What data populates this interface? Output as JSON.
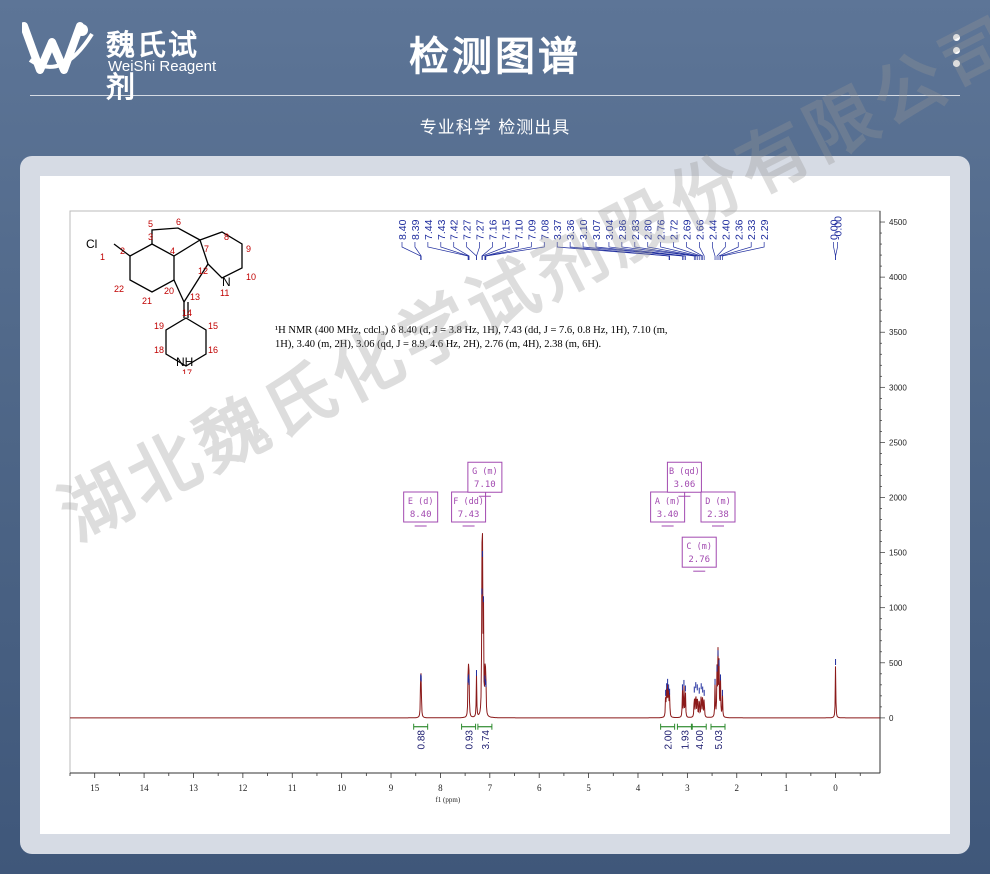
{
  "header": {
    "brand_cn": "魏氏试剂",
    "brand_en": "WeiShi Reagent",
    "title": "检测图谱",
    "subtitle": "专业科学  检测出具"
  },
  "watermark": "湖北魏氏化学试剂股份有限公司",
  "nmr_description": "¹H NMR (400 MHz, cdcl₃) δ 8.40 (d, J = 3.8 Hz, 1H), 7.43 (dd, J = 7.6, 0.8 Hz, 1H), 7.10 (m, 1H), 3.40 (m, 2H), 3.06 (qd, J = 8.9, 4.6 Hz, 2H), 2.76 (m, 4H), 2.38 (m, 6H).",
  "molecule": {
    "labels": [
      "Cl",
      "1",
      "2",
      "3",
      "4",
      "5",
      "6",
      "7",
      "8",
      "9",
      "10",
      "11",
      "12",
      "13",
      "14",
      "15",
      "16",
      "17",
      "18",
      "19",
      "20",
      "21",
      "22",
      "N",
      "NH"
    ]
  },
  "colors": {
    "spectrum": "#8b1a1a",
    "peaklabel": "#1f2d9e",
    "multiplet": "#a24ab0",
    "integral": "#2e8b2e",
    "axis": "#333333"
  },
  "chart_data": {
    "type": "line",
    "title": "",
    "xlabel": "f1 (ppm)",
    "ylabel": "",
    "xlim": [
      15.5,
      -0.9
    ],
    "ylim": [
      -500,
      4600
    ],
    "x_ticks": [
      15,
      14,
      13,
      12,
      11,
      10,
      9,
      8,
      7,
      6,
      5,
      4,
      3,
      2,
      1,
      0
    ],
    "x_tick_labels": [
      "15",
      "14",
      "13",
      "12",
      "11",
      "10",
      "9",
      "8",
      "7",
      "6",
      "5",
      "4",
      "3",
      "2",
      "1",
      "0"
    ],
    "y_ticks": [
      0,
      500,
      1000,
      1500,
      2000,
      2500,
      3000,
      3500,
      4000,
      4500
    ],
    "y_tick_labels": [
      "0",
      "500",
      "1000",
      "1500",
      "2000",
      "2500",
      "3000",
      "3500",
      "4000",
      "4500"
    ],
    "peak_labels": [
      "8.40",
      "8.39",
      "7.44",
      "7.43",
      "7.42",
      "7.27",
      "7.27",
      "7.16",
      "7.15",
      "7.10",
      "7.09",
      "7.08",
      "3.37",
      "3.36",
      "3.10",
      "3.07",
      "3.04",
      "2.86",
      "2.83",
      "2.80",
      "2.76",
      "2.72",
      "2.69",
      "2.66",
      "2.44",
      "2.40",
      "2.36",
      "2.33",
      "2.29",
      "0.00",
      "-0.00"
    ],
    "peaks": [
      {
        "x": 8.4,
        "h": 340
      },
      {
        "x": 8.39,
        "h": 330
      },
      {
        "x": 7.44,
        "h": 320
      },
      {
        "x": 7.43,
        "h": 340
      },
      {
        "x": 7.42,
        "h": 300
      },
      {
        "x": 7.27,
        "h": 380
      },
      {
        "x": 7.16,
        "h": 1120
      },
      {
        "x": 7.15,
        "h": 1460
      },
      {
        "x": 7.13,
        "h": 1050
      },
      {
        "x": 7.1,
        "h": 330
      },
      {
        "x": 7.09,
        "h": 300
      },
      {
        "x": 7.08,
        "h": 280
      },
      {
        "x": 3.44,
        "h": 200
      },
      {
        "x": 3.42,
        "h": 260
      },
      {
        "x": 3.4,
        "h": 300
      },
      {
        "x": 3.38,
        "h": 250
      },
      {
        "x": 3.36,
        "h": 210
      },
      {
        "x": 3.1,
        "h": 250
      },
      {
        "x": 3.07,
        "h": 290
      },
      {
        "x": 3.04,
        "h": 240
      },
      {
        "x": 2.86,
        "h": 230
      },
      {
        "x": 2.83,
        "h": 270
      },
      {
        "x": 2.8,
        "h": 250
      },
      {
        "x": 2.76,
        "h": 220
      },
      {
        "x": 2.72,
        "h": 260
      },
      {
        "x": 2.69,
        "h": 230
      },
      {
        "x": 2.66,
        "h": 200
      },
      {
        "x": 2.44,
        "h": 300
      },
      {
        "x": 2.4,
        "h": 420
      },
      {
        "x": 2.38,
        "h": 560
      },
      {
        "x": 2.36,
        "h": 470
      },
      {
        "x": 2.33,
        "h": 340
      },
      {
        "x": 2.29,
        "h": 200
      },
      {
        "x": 0.0,
        "h": 480
      }
    ],
    "multiplets": [
      {
        "letter": "E",
        "type": "d",
        "shift": "8.40",
        "x": 8.4,
        "label_y": 2050
      },
      {
        "letter": "F",
        "type": "dd",
        "shift": "7.43",
        "x": 7.43,
        "label_y": 2050
      },
      {
        "letter": "G",
        "type": "m",
        "shift": "7.10",
        "x": 7.1,
        "label_y": 2320
      },
      {
        "letter": "A",
        "type": "m",
        "shift": "3.40",
        "x": 3.4,
        "label_y": 2050
      },
      {
        "letter": "B",
        "type": "qd",
        "shift": "3.06",
        "x": 3.06,
        "label_y": 2320
      },
      {
        "letter": "D",
        "type": "m",
        "shift": "2.38",
        "x": 2.38,
        "label_y": 2050
      },
      {
        "letter": "C",
        "type": "m",
        "shift": "2.76",
        "x": 2.76,
        "label_y": 1640
      }
    ],
    "integrals": [
      {
        "x": 8.4,
        "value": "0.88"
      },
      {
        "x": 7.43,
        "value": "0.93"
      },
      {
        "x": 7.1,
        "value": "3.74"
      },
      {
        "x": 3.4,
        "value": "2.00"
      },
      {
        "x": 3.06,
        "value": "1.93"
      },
      {
        "x": 2.76,
        "value": "4.00"
      },
      {
        "x": 2.38,
        "value": "5.03"
      }
    ]
  }
}
